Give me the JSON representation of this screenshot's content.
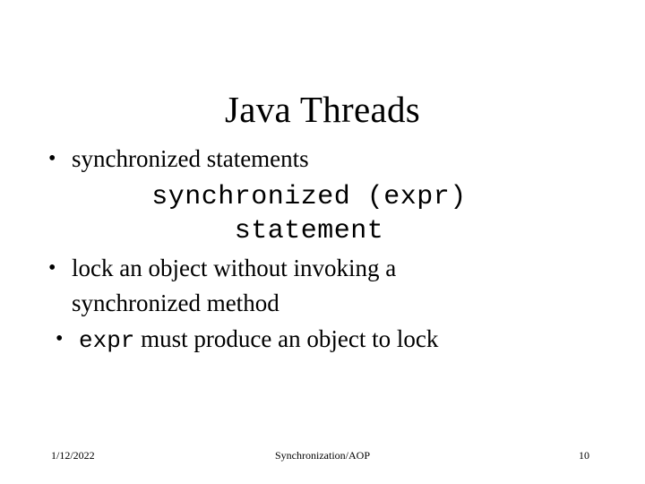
{
  "slide": {
    "title": "Java Threads",
    "bullet_char": "•",
    "bullets": [
      {
        "id": "synchronized-statements",
        "text": "synchronized statements"
      },
      {
        "id": "lock-object",
        "text": "lock an object without invoking a synchronized method"
      }
    ],
    "code_block": {
      "line1": "synchronized (expr)",
      "line2": "statement"
    },
    "expr_bullet": {
      "code": "expr",
      "text": " must produce an object to lock"
    }
  },
  "footer": {
    "date": "1/12/2022",
    "center": "Synchronization/AOP",
    "page_number": "10"
  },
  "colors": {
    "background": "#ffffff",
    "text": "#000000"
  }
}
